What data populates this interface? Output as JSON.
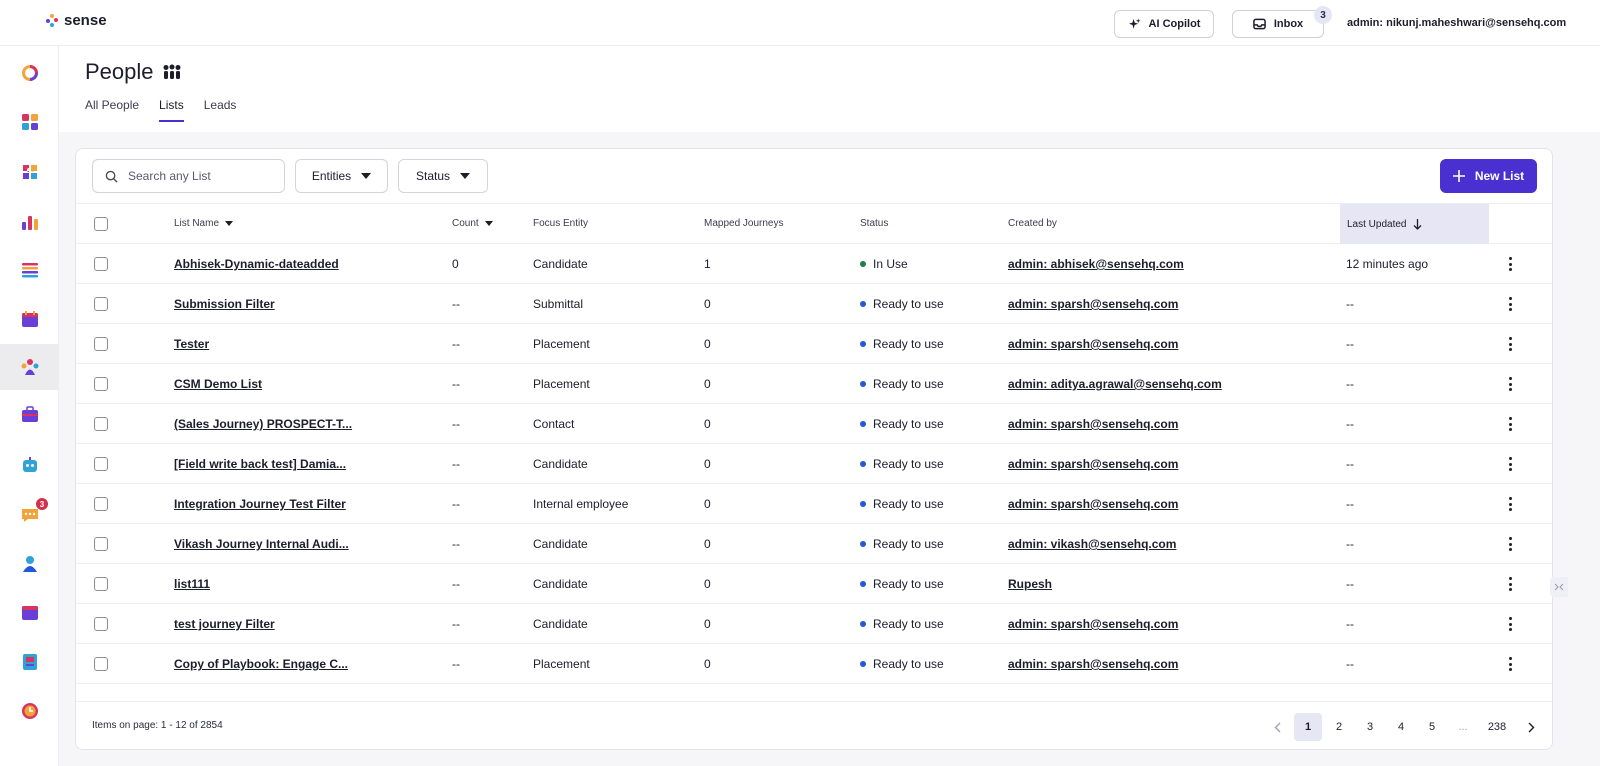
{
  "header": {
    "logo_text": "sense",
    "copilot_label": "AI Copilot",
    "inbox_label": "Inbox",
    "inbox_count": "3",
    "admin_email": "admin: nikunj.maheshwari@sensehq.com"
  },
  "sidebar": {
    "items": [
      {
        "icon": "ring-icon"
      },
      {
        "icon": "dashboard-icon"
      },
      {
        "icon": "puzzle-icon"
      },
      {
        "icon": "analytics-icon"
      },
      {
        "icon": "list-icon"
      },
      {
        "icon": "calendar-icon"
      },
      {
        "icon": "people-icon",
        "active": true
      },
      {
        "icon": "briefcase-icon"
      },
      {
        "icon": "bot-icon"
      },
      {
        "icon": "chat-icon",
        "badge": "3"
      },
      {
        "icon": "person-icon"
      },
      {
        "icon": "window-icon"
      },
      {
        "icon": "book-icon"
      },
      {
        "icon": "clock-icon"
      }
    ]
  },
  "page": {
    "title": "People",
    "tabs": [
      "All People",
      "Lists",
      "Leads"
    ],
    "active_tab": "Lists"
  },
  "toolbar": {
    "search_placeholder": "Search any List",
    "entities_label": "Entities",
    "status_label": "Status",
    "new_list_label": "New List"
  },
  "table": {
    "columns": {
      "list_name": "List Name",
      "count": "Count",
      "focus_entity": "Focus Entity",
      "mapped_journeys": "Mapped Journeys",
      "status": "Status",
      "created_by": "Created by",
      "last_updated": "Last Updated"
    },
    "rows": [
      {
        "name": "Abhisek-Dynamic-dateadded",
        "count": "0",
        "entity": "Candidate",
        "journeys": "1",
        "status": "In Use",
        "created_by": "admin: abhisek@sensehq.com",
        "updated": "12 minutes ago"
      },
      {
        "name": "Submission Filter",
        "count": "--",
        "entity": "Submittal",
        "journeys": "0",
        "status": "Ready to use",
        "created_by": "admin: sparsh@sensehq.com",
        "updated": "--"
      },
      {
        "name": "Tester",
        "count": "--",
        "entity": "Placement",
        "journeys": "0",
        "status": "Ready to use",
        "created_by": "admin: sparsh@sensehq.com",
        "updated": "--"
      },
      {
        "name": "CSM Demo List",
        "count": "--",
        "entity": "Placement",
        "journeys": "0",
        "status": "Ready to use",
        "created_by": "admin: aditya.agrawal@sensehq.com",
        "updated": "--"
      },
      {
        "name": "(Sales Journey) PROSPECT-T...",
        "count": "--",
        "entity": "Contact",
        "journeys": "0",
        "status": "Ready to use",
        "created_by": "admin: sparsh@sensehq.com",
        "updated": "--"
      },
      {
        "name": "[Field write back test] Damia...",
        "count": "--",
        "entity": "Candidate",
        "journeys": "0",
        "status": "Ready to use",
        "created_by": "admin: sparsh@sensehq.com",
        "updated": "--"
      },
      {
        "name": "Integration Journey Test Filter",
        "count": "--",
        "entity": "Internal employee",
        "journeys": "0",
        "status": "Ready to use",
        "created_by": "admin: sparsh@sensehq.com",
        "updated": "--"
      },
      {
        "name": "Vikash Journey Internal Audi...",
        "count": "--",
        "entity": "Candidate",
        "journeys": "0",
        "status": "Ready to use",
        "created_by": "admin: vikash@sensehq.com",
        "updated": "--"
      },
      {
        "name": "list111",
        "count": "--",
        "entity": "Candidate",
        "journeys": "0",
        "status": "Ready to use",
        "created_by": "Rupesh",
        "updated": "--"
      },
      {
        "name": "test journey Filter",
        "count": "--",
        "entity": "Candidate",
        "journeys": "0",
        "status": "Ready to use",
        "created_by": "admin: sparsh@sensehq.com",
        "updated": "--"
      },
      {
        "name": "Copy of Playbook: Engage C...",
        "count": "--",
        "entity": "Placement",
        "journeys": "0",
        "status": "Ready to use",
        "created_by": "admin: sparsh@sensehq.com",
        "updated": "--"
      }
    ]
  },
  "status_colors": {
    "In Use": "#1f7a4d",
    "Ready to use": "#2358d6"
  },
  "footer": {
    "items_label": "Items on page: 1 - 12 of 2854",
    "pages": [
      "1",
      "2",
      "3",
      "4",
      "5",
      "...",
      "238"
    ],
    "current_page": "1"
  },
  "colors": {
    "accent": "#4a2fd1",
    "sorted_header_bg": "#e6e6f5"
  }
}
